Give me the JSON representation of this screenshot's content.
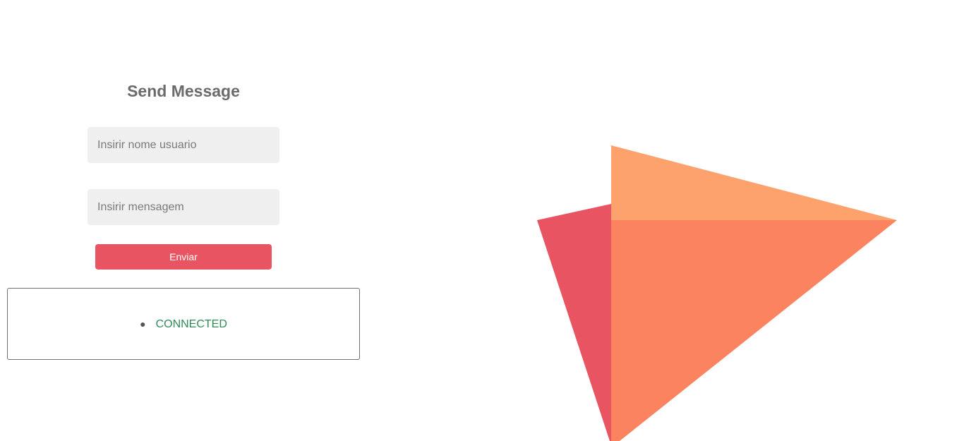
{
  "form": {
    "title": "Send Message",
    "username_placeholder": "Insirir nome usuario",
    "message_placeholder": "Insirir mensagem",
    "send_label": "Enviar"
  },
  "status": {
    "items": [
      "CONNECTED"
    ],
    "color": "#2e8b57"
  },
  "colors": {
    "accent": "#e85462",
    "input_bg": "#efefef",
    "art_red": "#e85462",
    "art_orange": "#fb8360",
    "art_light_orange": "#fda26d"
  },
  "decoration": {
    "icon": "paper-plane-icon"
  }
}
